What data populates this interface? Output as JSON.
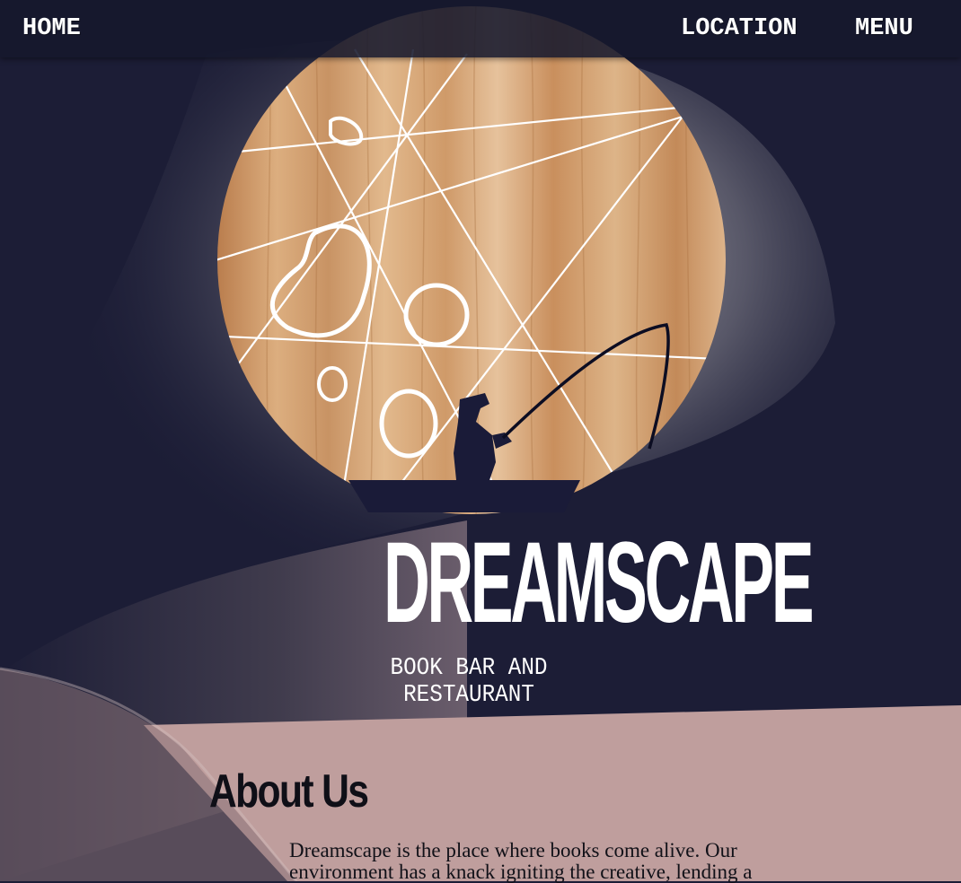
{
  "nav": {
    "home_label": "HOME",
    "location_label": "LOCATION",
    "menu_label": "MENU"
  },
  "hero": {
    "brand": "DREAMSCAPE",
    "tagline": "BOOK BAR AND RESTAURANT"
  },
  "about": {
    "title": "About Us",
    "body": "Dreamscape is the place where books come alive. Our environment has a knack igniting the creative, lending a"
  },
  "colors": {
    "navy": "#1c1d36",
    "rose": "#bf9e9d",
    "wood": "#d6a678",
    "white": "#ffffff"
  },
  "icons": {
    "fisherman": "fisherman-silhouette-icon",
    "boat": "boat-icon",
    "moon": "wood-moon-icon"
  }
}
